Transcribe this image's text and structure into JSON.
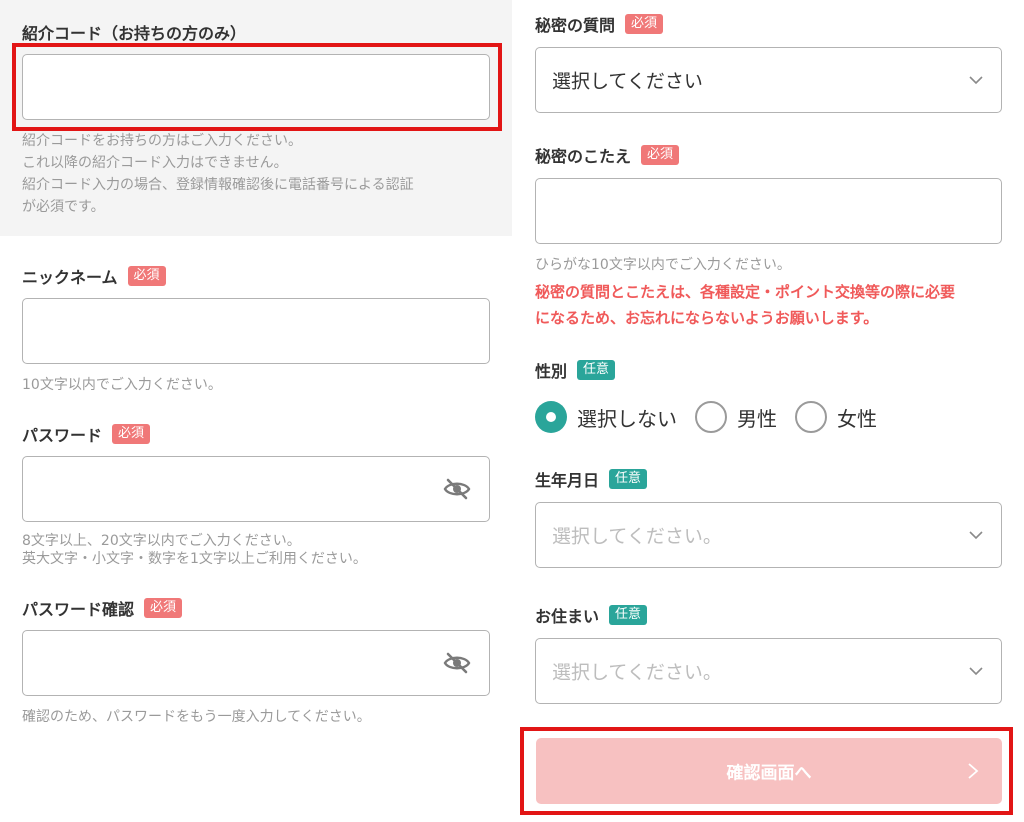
{
  "referral": {
    "label": "紹介コード（お持ちの方のみ）",
    "value": "",
    "hints": [
      "紹介コードをお持ちの方はご入力ください。",
      "これ以降の紹介コード入力はできません。",
      "紹介コード入力の場合、登録情報確認後に電話番号による認証",
      "が必須です。"
    ]
  },
  "nickname": {
    "label": "ニックネーム",
    "badge": "必須",
    "value": "",
    "hint": "10文字以内でご入力ください。"
  },
  "password": {
    "label": "パスワード",
    "badge": "必須",
    "value": "",
    "hints": [
      "8文字以上、20文字以内でご入力ください。",
      "英大文字・小文字・数字を1文字以上ご利用ください。"
    ]
  },
  "password_confirm": {
    "label": "パスワード確認",
    "badge": "必須",
    "value": "",
    "hint": "確認のため、パスワードをもう一度入力してください。"
  },
  "secret_question": {
    "label": "秘密の質問",
    "badge": "必須",
    "selected": "選択してください"
  },
  "secret_answer": {
    "label": "秘密のこたえ",
    "badge": "必須",
    "value": "",
    "hint": "ひらがな10文字以内でご入力ください。",
    "warning": [
      "秘密の質問とこたえは、各種設定・ポイント交換等の際に必要",
      "になるため、お忘れにならないようお願いします。"
    ]
  },
  "gender": {
    "label": "性別",
    "badge": "任意",
    "options": [
      "選択しない",
      "男性",
      "女性"
    ],
    "selected_index": 0
  },
  "birthday": {
    "label": "生年月日",
    "badge": "任意",
    "placeholder": "選択してください。"
  },
  "residence": {
    "label": "お住まい",
    "badge": "任意",
    "placeholder": "選択してください。"
  },
  "submit": {
    "label": "確認画面へ"
  },
  "colors": {
    "required_badge": "#f07878",
    "optional_badge": "#2aa59a",
    "warning_text": "#f05a5a",
    "submit_disabled": "#f7c1c1",
    "highlight_box": "#e21515"
  },
  "icons": {
    "password_toggle": "eye-slash-icon",
    "dropdown": "chevron-down-icon",
    "submit_arrow": "chevron-right-icon"
  }
}
